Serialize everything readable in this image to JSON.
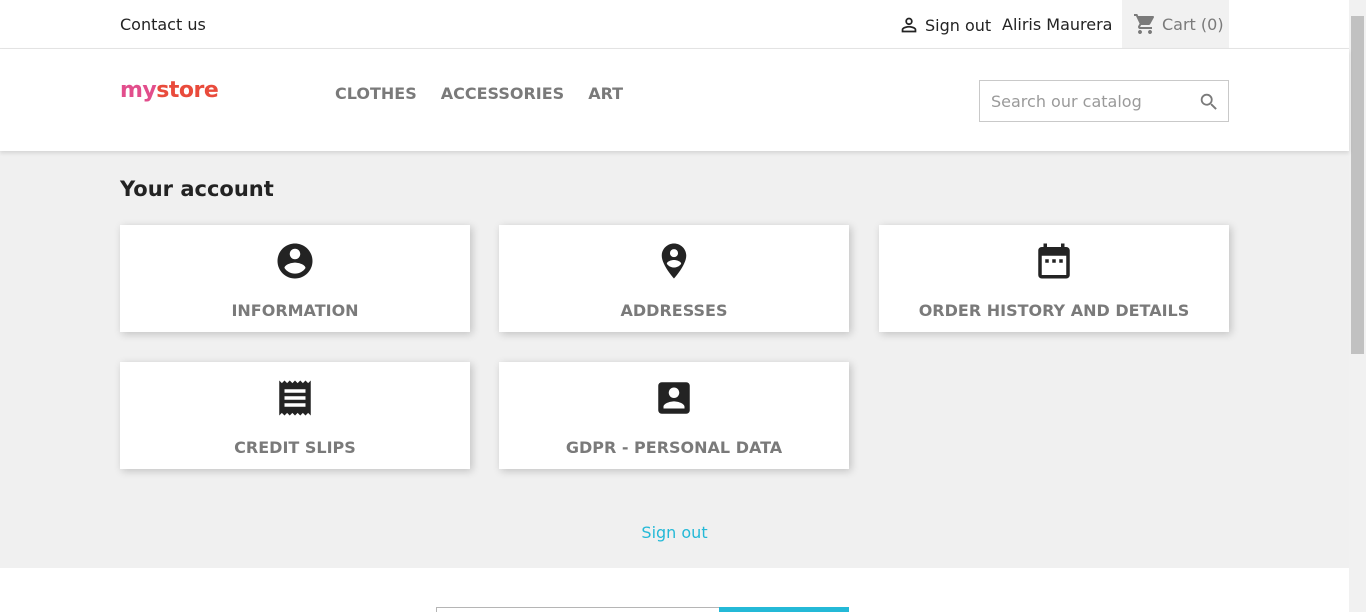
{
  "topbar": {
    "contact_label": "Contact us",
    "signout_label": "Sign out",
    "user_name": "Aliris Maurera",
    "cart_label": "Cart",
    "cart_count": "(0)"
  },
  "header": {
    "logo_text": [
      "my",
      " ",
      "store"
    ],
    "menu": [
      "Clothes",
      "Accessories",
      "Art"
    ],
    "search_placeholder": "Search our catalog"
  },
  "main": {
    "title": "Your account",
    "tiles": [
      {
        "label": "Information",
        "icon": "account-circle-icon"
      },
      {
        "label": "Addresses",
        "icon": "location-pin-icon"
      },
      {
        "label": "Order history and details",
        "icon": "calendar-icon"
      },
      {
        "label": "Credit slips",
        "icon": "receipt-icon"
      },
      {
        "label": "GDPR - Personal data",
        "icon": "account-box-icon"
      }
    ],
    "signout_link": "Sign out"
  },
  "colors": {
    "accent": "#24b9d7",
    "muted_text": "#7a7a7a",
    "background": "#f0f0f0"
  }
}
